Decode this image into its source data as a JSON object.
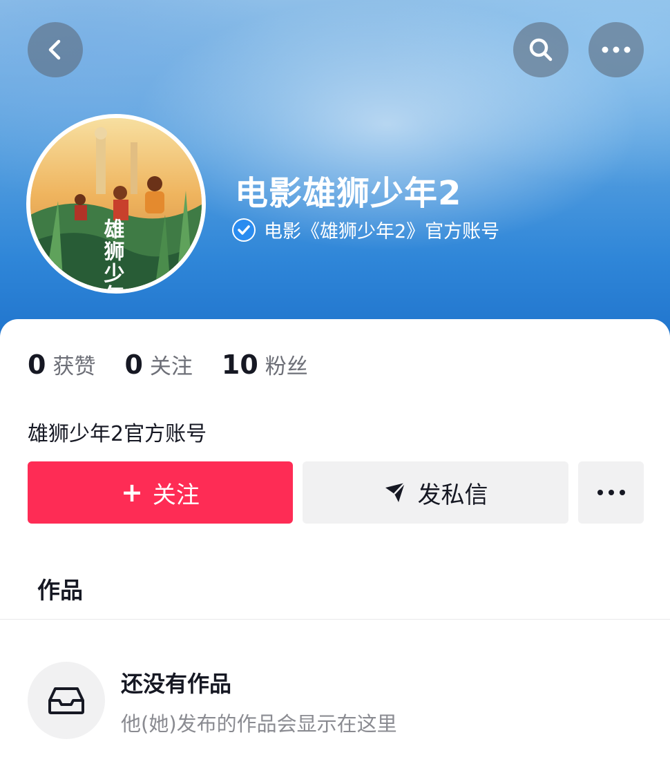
{
  "header": {
    "back_icon": "chevron-left-icon",
    "search_icon": "search-icon",
    "more_icon": "more-horizontal-icon"
  },
  "profile": {
    "name": "电影雄狮少年2",
    "verified_icon": "verified-check-icon",
    "verified_text": "电影《雄狮少年2》官方账号",
    "avatar_lettering": "雄狮少年"
  },
  "stats": [
    {
      "value": "0",
      "label": "获赞"
    },
    {
      "value": "0",
      "label": "关注"
    },
    {
      "value": "10",
      "label": "粉丝"
    }
  ],
  "bio": "雄狮少年2官方账号",
  "actions": {
    "follow_plus": "+",
    "follow_label": "关注",
    "message_label": "发私信",
    "message_icon": "send-icon",
    "extra_icon": "more-horizontal-icon"
  },
  "tabs": {
    "works": "作品"
  },
  "empty_state": {
    "icon": "inbox-icon",
    "title": "还没有作品",
    "subtitle": "他(她)发布的作品会显示在这里"
  },
  "colors": {
    "accent": "#fe2c55",
    "banner_blue": "#2f86d8",
    "button_grey": "#f1f1f2"
  }
}
